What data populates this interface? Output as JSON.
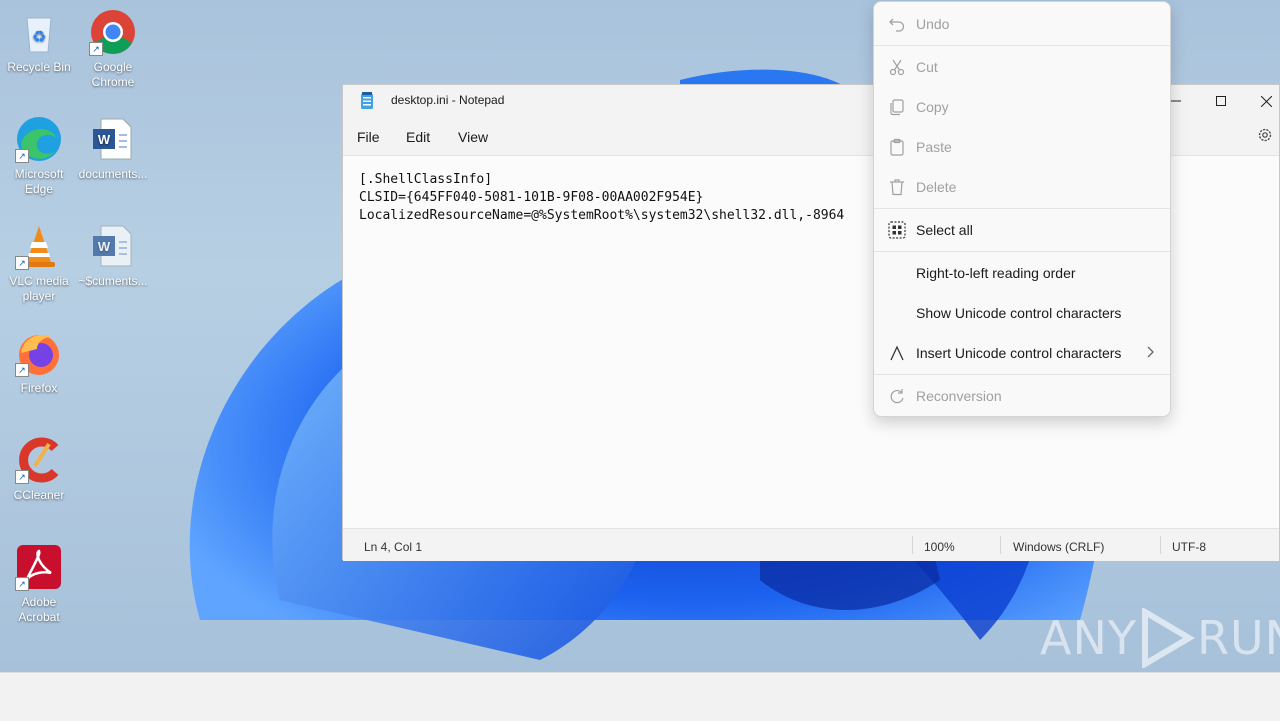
{
  "desktop_icons": [
    {
      "label": "Recycle Bin"
    },
    {
      "label": "Google Chrome"
    },
    {
      "label": "Microsoft Edge"
    },
    {
      "label": "documents..."
    },
    {
      "label": "VLC media player"
    },
    {
      "label": "~$cuments..."
    },
    {
      "label": "Firefox"
    },
    {
      "label": "CCleaner"
    },
    {
      "label": "Adobe Acrobat"
    }
  ],
  "notepad": {
    "title": "desktop.ini - Notepad",
    "menu": [
      "File",
      "Edit",
      "View"
    ],
    "content": [
      "[.ShellClassInfo]",
      "CLSID={645FF040-5081-101B-9F08-00AA002F954E}",
      "LocalizedResourceName=@%SystemRoot%\\system32\\shell32.dll,-8964"
    ],
    "status": {
      "position": "Ln 4, Col 1",
      "zoom": "100%",
      "line_ending": "Windows (CRLF)",
      "encoding": "UTF-8"
    }
  },
  "context_menu": {
    "items": [
      {
        "label": "Undo",
        "icon": "undo-icon",
        "enabled": false
      },
      {
        "label": "Cut",
        "icon": "scissors-icon",
        "enabled": false
      },
      {
        "label": "Copy",
        "icon": "copy-icon",
        "enabled": false
      },
      {
        "label": "Paste",
        "icon": "clipboard-icon",
        "enabled": false
      },
      {
        "label": "Delete",
        "icon": "trash-icon",
        "enabled": false
      },
      {
        "label": "Select all",
        "icon": "select-all-icon",
        "enabled": true
      },
      {
        "label": "Right-to-left reading order",
        "enabled": true
      },
      {
        "label": "Show Unicode control characters",
        "enabled": true
      },
      {
        "label": "Insert Unicode control characters",
        "icon": "caret-icon",
        "enabled": true,
        "submenu": true
      },
      {
        "label": "Reconversion",
        "icon": "reconversion-icon",
        "enabled": false
      }
    ]
  },
  "watermark": {
    "left": "ANY",
    "right": "RUN"
  },
  "colors": {
    "wallpaper": "#a9c3dc",
    "bloom": "#1e6ef0",
    "taskbar": "#f2f2f2"
  }
}
